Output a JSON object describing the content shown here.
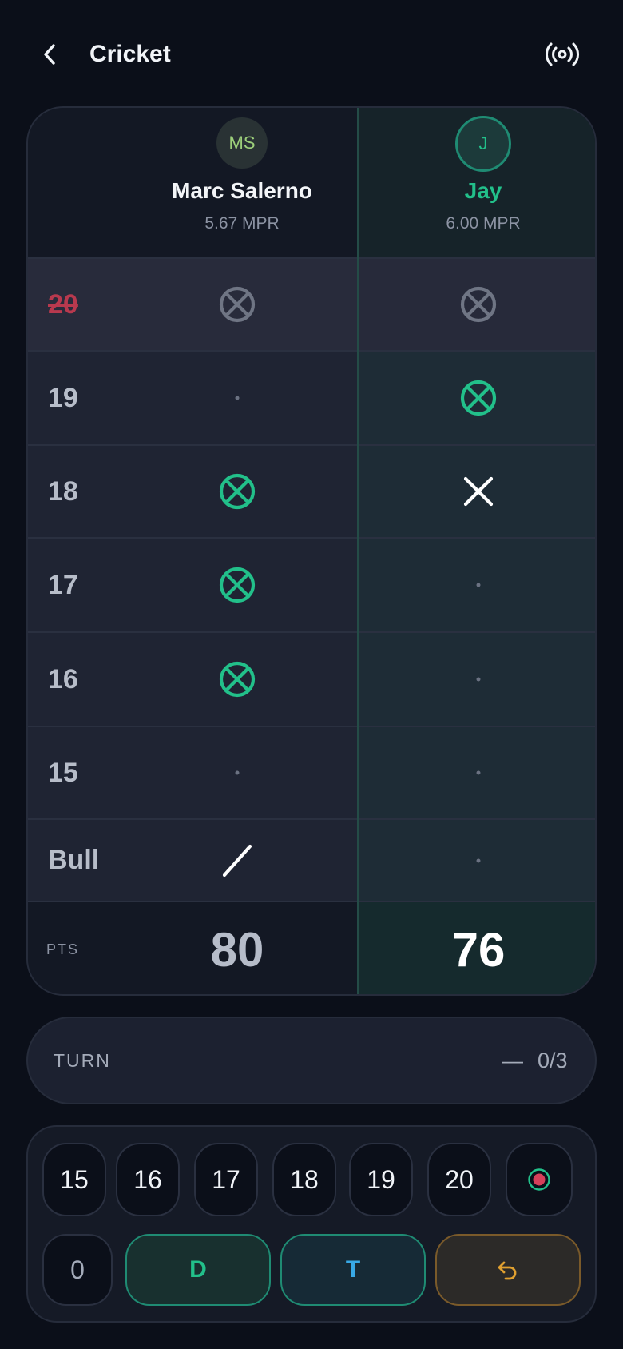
{
  "header": {
    "title": "Cricket",
    "back_icon": "chevron-left-icon",
    "action_icon": "broadcast-icon"
  },
  "players": [
    {
      "initials": "MS",
      "name": "Marc Salerno",
      "mpr": "5.67 MPR",
      "active": false
    },
    {
      "initials": "J",
      "name": "Jay",
      "mpr": "6.00 MPR",
      "active": true
    }
  ],
  "rows": [
    {
      "label": "20",
      "closed": true,
      "marks": [
        "closed",
        "closed"
      ]
    },
    {
      "label": "19",
      "closed": false,
      "marks": [
        "none",
        "three"
      ]
    },
    {
      "label": "18",
      "closed": false,
      "marks": [
        "three",
        "two"
      ]
    },
    {
      "label": "17",
      "closed": false,
      "marks": [
        "three",
        "none"
      ]
    },
    {
      "label": "16",
      "closed": false,
      "marks": [
        "three",
        "none"
      ]
    },
    {
      "label": "15",
      "closed": false,
      "marks": [
        "none",
        "none"
      ]
    },
    {
      "label": "Bull",
      "closed": false,
      "marks": [
        "one",
        "none"
      ]
    }
  ],
  "points": {
    "label": "PTS",
    "values": [
      "80",
      "76"
    ]
  },
  "turn": {
    "label": "TURN",
    "dash": "—",
    "count": "0/3"
  },
  "keypad": {
    "numbers": [
      "15",
      "16",
      "17",
      "18",
      "19",
      "20"
    ],
    "bull_icon": "bullseye-icon",
    "zero": "0",
    "double": "D",
    "triple": "T",
    "undo_icon": "undo-icon"
  },
  "colors": {
    "accent": "#22c08a",
    "closed": "#b8394e",
    "bull": "#d6405a",
    "undo": "#e0a030",
    "triple": "#38a9e6"
  }
}
